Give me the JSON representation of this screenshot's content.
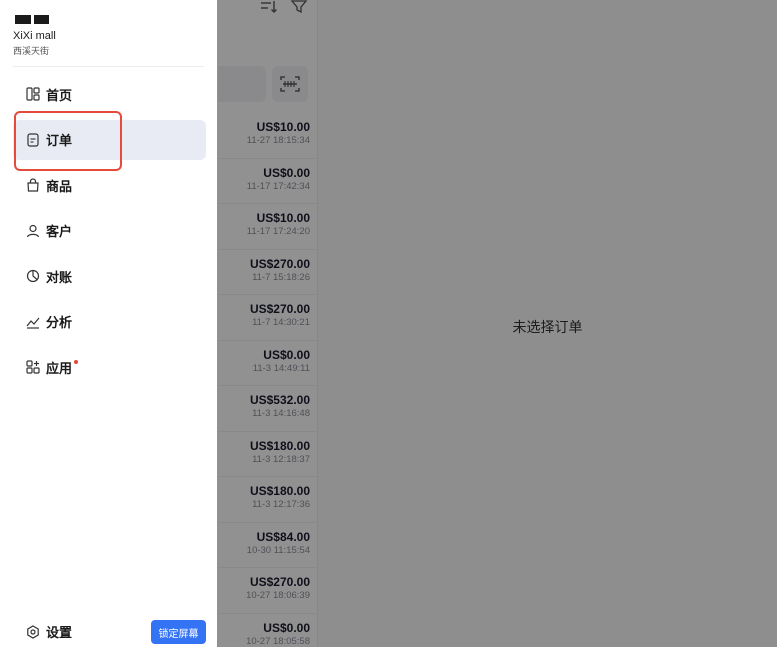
{
  "drawer": {
    "store_name": "XiXi mall",
    "store_location": "西溪天街",
    "nav": [
      {
        "label": "首页",
        "icon": "home-grid-icon",
        "active": false
      },
      {
        "label": "订单",
        "icon": "order-doc-icon",
        "active": true
      },
      {
        "label": "商品",
        "icon": "shopping-bag-icon",
        "active": false
      },
      {
        "label": "客户",
        "icon": "user-icon",
        "active": false
      },
      {
        "label": "对账",
        "icon": "pie-chart-icon",
        "active": false
      },
      {
        "label": "分析",
        "icon": "trend-chart-icon",
        "active": false
      },
      {
        "label": "应用",
        "icon": "apps-grid-icon",
        "active": false,
        "badge": true
      }
    ],
    "settings_label": "设置",
    "lock_screen_label": "锁定屏幕"
  },
  "orders": [
    {
      "amount": "US$10.00",
      "time": "11-27 18:15:34"
    },
    {
      "amount": "US$0.00",
      "time": "11-17 17:42:34"
    },
    {
      "amount": "US$10.00",
      "time": "11-17 17:24:20"
    },
    {
      "amount": "US$270.00",
      "time": "11-7 15:18:26"
    },
    {
      "amount": "US$270.00",
      "time": "11-7 14:30:21"
    },
    {
      "amount": "US$0.00",
      "time": "11-3 14:49:11"
    },
    {
      "amount": "US$532.00",
      "time": "11-3 14:16:48"
    },
    {
      "amount": "US$180.00",
      "time": "11-3 12:18:37"
    },
    {
      "amount": "US$180.00",
      "time": "11-3 12:17:36"
    },
    {
      "amount": "US$84.00",
      "time": "10-30 11:15:54"
    },
    {
      "amount": "US$270.00",
      "time": "10-27 18:06:39"
    },
    {
      "amount": "US$0.00",
      "time": "10-27 18:05:58"
    }
  ],
  "detail": {
    "empty_text": "未选择订单"
  },
  "colors": {
    "accent": "#3573f5",
    "highlight": "#e54a3a",
    "badge": "#e5483a"
  }
}
